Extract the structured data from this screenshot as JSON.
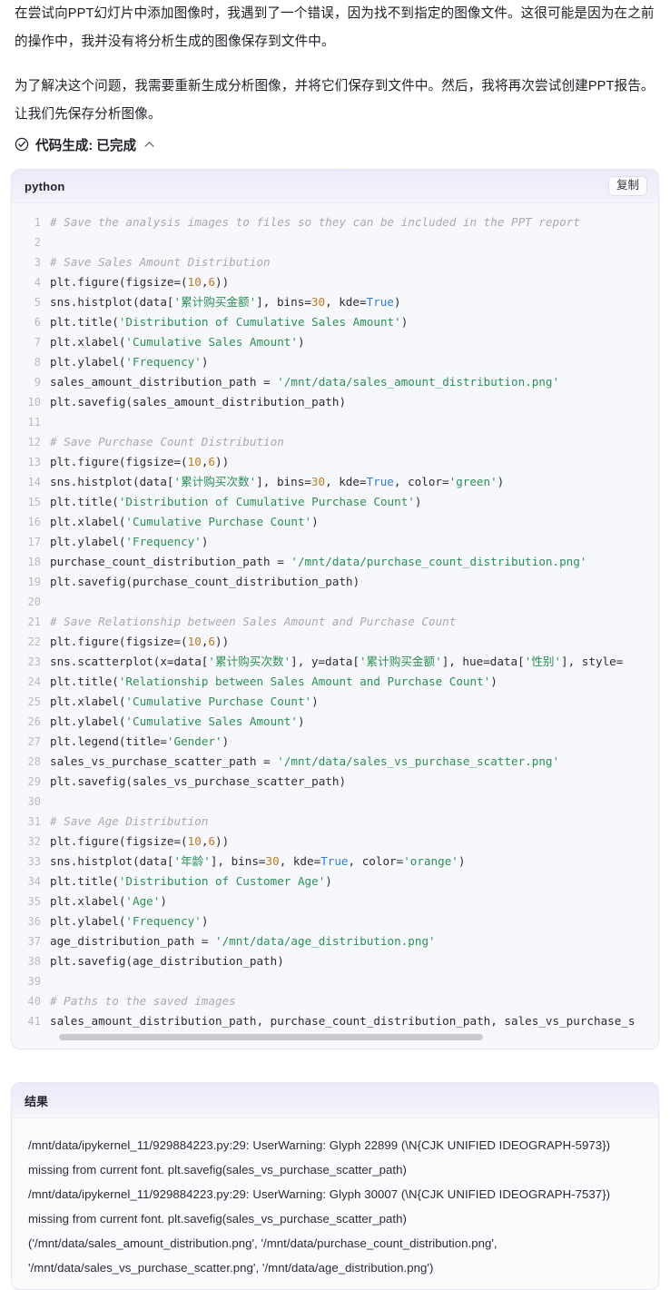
{
  "intro": {
    "paragraph1": "在尝试向PPT幻灯片中添加图像时，我遇到了一个错误，因为找不到指定的图像文件。这很可能是因为在之前的操作中，我并没有将分析生成的图像保存到文件中。",
    "paragraph2": "为了解决这个问题，我需要重新生成分析图像，并将它们保存到文件中。然后，我将再次尝试创建PPT报告。让我们先保存分析图像。"
  },
  "status": {
    "icon": "check-circle-icon",
    "label": "代码生成: 已完成",
    "chevron": "︿"
  },
  "code_block": {
    "language": "python",
    "copy_label": "复制",
    "lines": [
      {
        "n": "1",
        "tokens": [
          {
            "t": "com",
            "s": "# Save the analysis images to files so they can be included in the PPT report"
          }
        ]
      },
      {
        "n": "2",
        "tokens": []
      },
      {
        "n": "3",
        "tokens": [
          {
            "t": "com",
            "s": "# Save Sales Amount Distribution"
          }
        ]
      },
      {
        "n": "4",
        "tokens": [
          {
            "t": "pln",
            "s": "plt.figure(figsize=("
          },
          {
            "t": "num",
            "s": "10"
          },
          {
            "t": "pln",
            "s": ","
          },
          {
            "t": "num",
            "s": "6"
          },
          {
            "t": "pln",
            "s": "))"
          }
        ]
      },
      {
        "n": "5",
        "tokens": [
          {
            "t": "pln",
            "s": "sns.histplot(data["
          },
          {
            "t": "str",
            "s": "'累计购买金额'"
          },
          {
            "t": "pln",
            "s": "], bins="
          },
          {
            "t": "num",
            "s": "30"
          },
          {
            "t": "pln",
            "s": ", kde="
          },
          {
            "t": "kw",
            "s": "True"
          },
          {
            "t": "pln",
            "s": ")"
          }
        ]
      },
      {
        "n": "6",
        "tokens": [
          {
            "t": "pln",
            "s": "plt.title("
          },
          {
            "t": "str",
            "s": "'Distribution of Cumulative Sales Amount'"
          },
          {
            "t": "pln",
            "s": ")"
          }
        ]
      },
      {
        "n": "7",
        "tokens": [
          {
            "t": "pln",
            "s": "plt.xlabel("
          },
          {
            "t": "str",
            "s": "'Cumulative Sales Amount'"
          },
          {
            "t": "pln",
            "s": ")"
          }
        ]
      },
      {
        "n": "8",
        "tokens": [
          {
            "t": "pln",
            "s": "plt.ylabel("
          },
          {
            "t": "str",
            "s": "'Frequency'"
          },
          {
            "t": "pln",
            "s": ")"
          }
        ]
      },
      {
        "n": "9",
        "tokens": [
          {
            "t": "pln",
            "s": "sales_amount_distribution_path = "
          },
          {
            "t": "str",
            "s": "'/mnt/data/sales_amount_distribution.png'"
          }
        ]
      },
      {
        "n": "10",
        "tokens": [
          {
            "t": "pln",
            "s": "plt.savefig(sales_amount_distribution_path)"
          }
        ]
      },
      {
        "n": "11",
        "tokens": []
      },
      {
        "n": "12",
        "tokens": [
          {
            "t": "com",
            "s": "# Save Purchase Count Distribution"
          }
        ]
      },
      {
        "n": "13",
        "tokens": [
          {
            "t": "pln",
            "s": "plt.figure(figsize=("
          },
          {
            "t": "num",
            "s": "10"
          },
          {
            "t": "pln",
            "s": ","
          },
          {
            "t": "num",
            "s": "6"
          },
          {
            "t": "pln",
            "s": "))"
          }
        ]
      },
      {
        "n": "14",
        "tokens": [
          {
            "t": "pln",
            "s": "sns.histplot(data["
          },
          {
            "t": "str",
            "s": "'累计购买次数'"
          },
          {
            "t": "pln",
            "s": "], bins="
          },
          {
            "t": "num",
            "s": "30"
          },
          {
            "t": "pln",
            "s": ", kde="
          },
          {
            "t": "kw",
            "s": "True"
          },
          {
            "t": "pln",
            "s": ", color="
          },
          {
            "t": "str",
            "s": "'green'"
          },
          {
            "t": "pln",
            "s": ")"
          }
        ]
      },
      {
        "n": "15",
        "tokens": [
          {
            "t": "pln",
            "s": "plt.title("
          },
          {
            "t": "str",
            "s": "'Distribution of Cumulative Purchase Count'"
          },
          {
            "t": "pln",
            "s": ")"
          }
        ]
      },
      {
        "n": "16",
        "tokens": [
          {
            "t": "pln",
            "s": "plt.xlabel("
          },
          {
            "t": "str",
            "s": "'Cumulative Purchase Count'"
          },
          {
            "t": "pln",
            "s": ")"
          }
        ]
      },
      {
        "n": "17",
        "tokens": [
          {
            "t": "pln",
            "s": "plt.ylabel("
          },
          {
            "t": "str",
            "s": "'Frequency'"
          },
          {
            "t": "pln",
            "s": ")"
          }
        ]
      },
      {
        "n": "18",
        "tokens": [
          {
            "t": "pln",
            "s": "purchase_count_distribution_path = "
          },
          {
            "t": "str",
            "s": "'/mnt/data/purchase_count_distribution.png'"
          }
        ]
      },
      {
        "n": "19",
        "tokens": [
          {
            "t": "pln",
            "s": "plt.savefig(purchase_count_distribution_path)"
          }
        ]
      },
      {
        "n": "20",
        "tokens": []
      },
      {
        "n": "21",
        "tokens": [
          {
            "t": "com",
            "s": "# Save Relationship between Sales Amount and Purchase Count"
          }
        ]
      },
      {
        "n": "22",
        "tokens": [
          {
            "t": "pln",
            "s": "plt.figure(figsize=("
          },
          {
            "t": "num",
            "s": "10"
          },
          {
            "t": "pln",
            "s": ","
          },
          {
            "t": "num",
            "s": "6"
          },
          {
            "t": "pln",
            "s": "))"
          }
        ]
      },
      {
        "n": "23",
        "tokens": [
          {
            "t": "pln",
            "s": "sns.scatterplot(x=data["
          },
          {
            "t": "str",
            "s": "'累计购买次数'"
          },
          {
            "t": "pln",
            "s": "], y=data["
          },
          {
            "t": "str",
            "s": "'累计购买金额'"
          },
          {
            "t": "pln",
            "s": "], hue=data["
          },
          {
            "t": "str",
            "s": "'性别'"
          },
          {
            "t": "pln",
            "s": "], style="
          }
        ]
      },
      {
        "n": "24",
        "tokens": [
          {
            "t": "pln",
            "s": "plt.title("
          },
          {
            "t": "str",
            "s": "'Relationship between Sales Amount and Purchase Count'"
          },
          {
            "t": "pln",
            "s": ")"
          }
        ]
      },
      {
        "n": "25",
        "tokens": [
          {
            "t": "pln",
            "s": "plt.xlabel("
          },
          {
            "t": "str",
            "s": "'Cumulative Purchase Count'"
          },
          {
            "t": "pln",
            "s": ")"
          }
        ]
      },
      {
        "n": "26",
        "tokens": [
          {
            "t": "pln",
            "s": "plt.ylabel("
          },
          {
            "t": "str",
            "s": "'Cumulative Sales Amount'"
          },
          {
            "t": "pln",
            "s": ")"
          }
        ]
      },
      {
        "n": "27",
        "tokens": [
          {
            "t": "pln",
            "s": "plt.legend(title="
          },
          {
            "t": "str",
            "s": "'Gender'"
          },
          {
            "t": "pln",
            "s": ")"
          }
        ]
      },
      {
        "n": "28",
        "tokens": [
          {
            "t": "pln",
            "s": "sales_vs_purchase_scatter_path = "
          },
          {
            "t": "str",
            "s": "'/mnt/data/sales_vs_purchase_scatter.png'"
          }
        ]
      },
      {
        "n": "29",
        "tokens": [
          {
            "t": "pln",
            "s": "plt.savefig(sales_vs_purchase_scatter_path)"
          }
        ]
      },
      {
        "n": "30",
        "tokens": []
      },
      {
        "n": "31",
        "tokens": [
          {
            "t": "com",
            "s": "# Save Age Distribution"
          }
        ]
      },
      {
        "n": "32",
        "tokens": [
          {
            "t": "pln",
            "s": "plt.figure(figsize=("
          },
          {
            "t": "num",
            "s": "10"
          },
          {
            "t": "pln",
            "s": ","
          },
          {
            "t": "num",
            "s": "6"
          },
          {
            "t": "pln",
            "s": "))"
          }
        ]
      },
      {
        "n": "33",
        "tokens": [
          {
            "t": "pln",
            "s": "sns.histplot(data["
          },
          {
            "t": "str",
            "s": "'年龄'"
          },
          {
            "t": "pln",
            "s": "], bins="
          },
          {
            "t": "num",
            "s": "30"
          },
          {
            "t": "pln",
            "s": ", kde="
          },
          {
            "t": "kw",
            "s": "True"
          },
          {
            "t": "pln",
            "s": ", color="
          },
          {
            "t": "str",
            "s": "'orange'"
          },
          {
            "t": "pln",
            "s": ")"
          }
        ]
      },
      {
        "n": "34",
        "tokens": [
          {
            "t": "pln",
            "s": "plt.title("
          },
          {
            "t": "str",
            "s": "'Distribution of Customer Age'"
          },
          {
            "t": "pln",
            "s": ")"
          }
        ]
      },
      {
        "n": "35",
        "tokens": [
          {
            "t": "pln",
            "s": "plt.xlabel("
          },
          {
            "t": "str",
            "s": "'Age'"
          },
          {
            "t": "pln",
            "s": ")"
          }
        ]
      },
      {
        "n": "36",
        "tokens": [
          {
            "t": "pln",
            "s": "plt.ylabel("
          },
          {
            "t": "str",
            "s": "'Frequency'"
          },
          {
            "t": "pln",
            "s": ")"
          }
        ]
      },
      {
        "n": "37",
        "tokens": [
          {
            "t": "pln",
            "s": "age_distribution_path = "
          },
          {
            "t": "str",
            "s": "'/mnt/data/age_distribution.png'"
          }
        ]
      },
      {
        "n": "38",
        "tokens": [
          {
            "t": "pln",
            "s": "plt.savefig(age_distribution_path)"
          }
        ]
      },
      {
        "n": "39",
        "tokens": []
      },
      {
        "n": "40",
        "tokens": [
          {
            "t": "com",
            "s": "# Paths to the saved images"
          }
        ]
      },
      {
        "n": "41",
        "tokens": [
          {
            "t": "pln",
            "s": "sales_amount_distribution_path, purchase_count_distribution_path, sales_vs_purchase_s"
          }
        ]
      }
    ]
  },
  "result_block": {
    "title": "结果",
    "lines": [
      "/mnt/data/ipykernel_11/929884223.py:29: UserWarning: Glyph 22899 (\\N{CJK UNIFIED IDEOGRAPH-5973}) missing from current font. plt.savefig(sales_vs_purchase_scatter_path)",
      "/mnt/data/ipykernel_11/929884223.py:29: UserWarning: Glyph 30007 (\\N{CJK UNIFIED IDEOGRAPH-7537}) missing from current font. plt.savefig(sales_vs_purchase_scatter_path)",
      "('/mnt/data/sales_amount_distribution.png', '/mnt/data/purchase_count_distribution.png', '/mnt/data/sales_vs_purchase_scatter.png', '/mnt/data/age_distribution.png')"
    ]
  },
  "colors": {
    "string": "#2a9156",
    "number": "#c07a1e",
    "keyword": "#2f7fd8",
    "comment": "#a8a9b4",
    "header_tint": "#eceaf8"
  }
}
